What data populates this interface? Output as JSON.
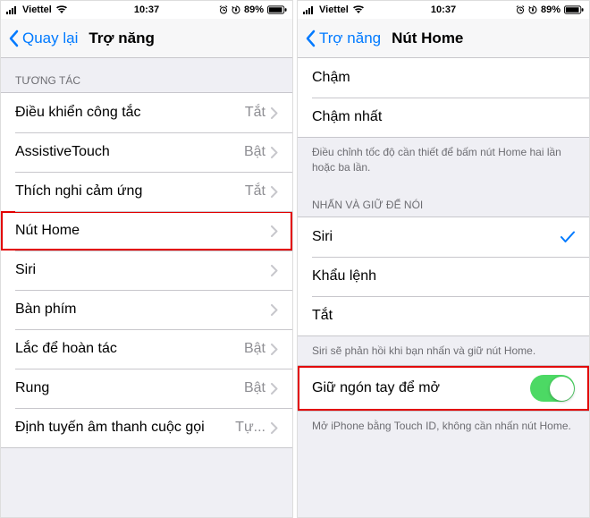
{
  "status": {
    "carrier": "Viettel",
    "time": "10:37",
    "battery": "89%"
  },
  "left": {
    "nav_back": "Quay lại",
    "nav_title": "Trợ năng",
    "section_header": "TƯƠNG TÁC",
    "rows": [
      {
        "label": "Điều khiển công tắc",
        "value": "Tắt"
      },
      {
        "label": "AssistiveTouch",
        "value": "Bật"
      },
      {
        "label": "Thích nghi cảm ứng",
        "value": "Tắt"
      },
      {
        "label": "Nút Home",
        "value": ""
      },
      {
        "label": "Siri",
        "value": ""
      },
      {
        "label": "Bàn phím",
        "value": ""
      },
      {
        "label": "Lắc để hoàn tác",
        "value": "Bật"
      },
      {
        "label": "Rung",
        "value": "Bật"
      },
      {
        "label": "Định tuyến âm thanh cuộc gọi",
        "value": "Tự..."
      }
    ]
  },
  "right": {
    "nav_back": "Trợ năng",
    "nav_title": "Nút Home",
    "speed_rows": [
      {
        "label": "Chậm"
      },
      {
        "label": "Chậm nhất"
      }
    ],
    "speed_footer": "Điều chỉnh tốc độ cần thiết để bấm nút Home hai lần hoặc ba lần.",
    "hold_header": "NHẤN VÀ GIỮ ĐỂ NÓI",
    "hold_rows": [
      {
        "label": "Siri",
        "checked": true
      },
      {
        "label": "Khẩu lệnh",
        "checked": false
      },
      {
        "label": "Tắt",
        "checked": false
      }
    ],
    "hold_footer": "Siri sẽ phản hồi khi bạn nhấn và giữ nút Home.",
    "rest_row": {
      "label": "Giữ ngón tay để mở",
      "toggle_on": true
    },
    "rest_footer": "Mở iPhone bằng Touch ID, không cần nhấn nút Home."
  }
}
